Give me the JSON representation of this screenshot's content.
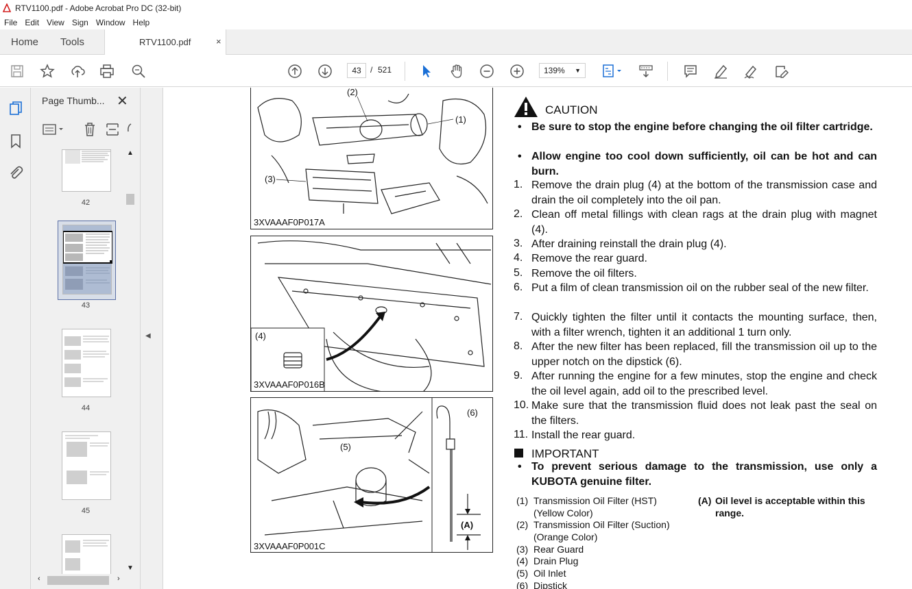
{
  "window": {
    "title": "RTV1100.pdf - Adobe Acrobat Pro DC (32-bit)"
  },
  "menu": [
    "File",
    "Edit",
    "View",
    "Sign",
    "Window",
    "Help"
  ],
  "tabs": {
    "home": "Home",
    "tools": "Tools",
    "document": "RTV1100.pdf",
    "close": "×"
  },
  "toolbar": {
    "current_page": "43",
    "separator": "/",
    "total_pages": "521",
    "zoom": "139%"
  },
  "thumbnails": {
    "panel_title": "Page Thumb...",
    "close": "✕",
    "pages": [
      {
        "label": "42",
        "selected": false
      },
      {
        "label": "43",
        "selected": true
      },
      {
        "label": "44",
        "selected": false
      },
      {
        "label": "45",
        "selected": false
      },
      {
        "label": "",
        "selected": false
      }
    ]
  },
  "document": {
    "figures": [
      {
        "code": "3XVAAAF0P017A",
        "callouts": [
          "(2)",
          "(1)",
          "(3)"
        ]
      },
      {
        "code": "3XVAAAF0P016B",
        "callouts": [
          "(4)"
        ]
      },
      {
        "code": "3XVAAAF0P001C",
        "callouts": [
          "(6)",
          "(5)",
          "(A)"
        ]
      }
    ],
    "caution": {
      "title": "CAUTION",
      "bullets": [
        "Be sure to stop the engine before changing the oil filter cartridge.",
        "Allow engine too cool down sufficiently, oil can be hot and can burn."
      ]
    },
    "steps": [
      {
        "num": "1.",
        "text": "Remove the drain plug (4) at the bottom of the transmission case and drain the oil completely into the oil pan."
      },
      {
        "num": "2.",
        "text": "Clean off metal fillings with clean rags at the drain plug with magnet (4)."
      },
      {
        "num": "3.",
        "text": "After draining reinstall the drain plug (4)."
      },
      {
        "num": "4.",
        "text": "Remove the rear guard."
      },
      {
        "num": "5.",
        "text": "Remove the oil filters."
      },
      {
        "num": "6.",
        "text": "Put a film of clean transmission oil on the rubber seal of the new filter."
      },
      {
        "num": "7.",
        "text": "Quickly tighten the filter until it contacts the mounting surface, then, with a filter wrench, tighten it an additional 1 turn only."
      },
      {
        "num": "8.",
        "text": "After the new filter has been replaced, fill the transmission oil up to the upper notch on the dipstick (6)."
      },
      {
        "num": "9.",
        "text": "After running the engine for a few minutes, stop the engine and check the oil level again, add oil to the prescribed level."
      },
      {
        "num": "10.",
        "text": "Make sure that the transmission fluid does not leak past the seal on the filters."
      },
      {
        "num": "11.",
        "text": "Install the rear guard."
      }
    ],
    "important": {
      "title": "IMPORTANT",
      "bullet": "To prevent serious damage to the transmission, use only a KUBOTA genuine filter."
    },
    "legend": [
      {
        "key": "(1)",
        "text": "Transmission Oil Filter (HST) (Yellow Color)"
      },
      {
        "key": "(2)",
        "text": "Transmission Oil Filter (Suction) (Orange Color)"
      },
      {
        "key": "(3)",
        "text": "Rear Guard"
      },
      {
        "key": "(4)",
        "text": "Drain Plug"
      },
      {
        "key": "(5)",
        "text": "Oil Inlet"
      },
      {
        "key": "(6)",
        "text": "Dipstick"
      }
    ],
    "legend_a": {
      "key": "(A)",
      "text": "Oil level is acceptable within this range."
    }
  }
}
